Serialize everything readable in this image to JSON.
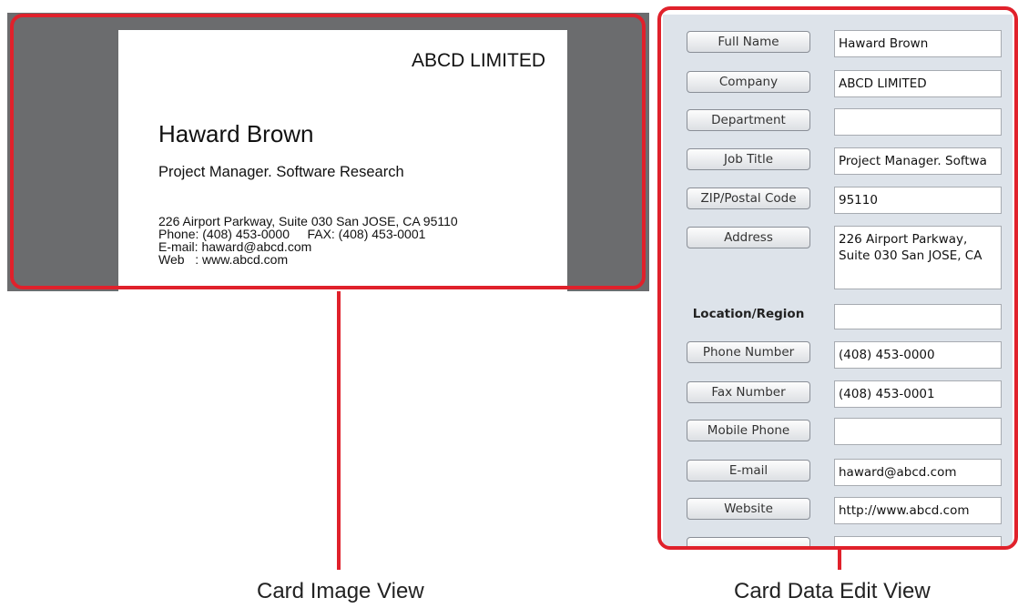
{
  "card_image": {
    "company": "ABCD LIMITED",
    "name": "Haward Brown",
    "job_title": "Project Manager. Software Research",
    "lines": [
      "226 Airport Parkway, Suite 030 San JOSE, CA 95110",
      "Phone: (408) 453-0000     FAX: (408) 453-0001",
      "E-mail: haward@abcd.com",
      "Web   : www.abcd.com"
    ]
  },
  "edit_view": {
    "fields": [
      {
        "label": "Full Name",
        "value": "Haward Brown",
        "kind": "button"
      },
      {
        "label": "Company",
        "value": "ABCD LIMITED",
        "kind": "button"
      },
      {
        "label": "Department",
        "value": "",
        "kind": "button"
      },
      {
        "label": "Job Title",
        "value": "Project Manager. Softwa",
        "kind": "button"
      },
      {
        "label": "ZIP/Postal Code",
        "value": "95110",
        "kind": "button"
      },
      {
        "label": "Address",
        "value": "226 Airport Parkway,\nSuite 030 San JOSE, CA",
        "kind": "button"
      },
      {
        "label": "Location/Region",
        "value": "",
        "kind": "label"
      },
      {
        "label": "Phone Number",
        "value": "(408) 453-0000",
        "kind": "button"
      },
      {
        "label": "Fax Number",
        "value": "(408) 453-0001",
        "kind": "button"
      },
      {
        "label": "Mobile Phone",
        "value": "",
        "kind": "button"
      },
      {
        "label": "E-mail",
        "value": "haward@abcd.com",
        "kind": "button"
      },
      {
        "label": "Website",
        "value": "http://www.abcd.com",
        "kind": "button"
      },
      {
        "label": "",
        "value": "",
        "kind": "button"
      }
    ]
  },
  "captions": {
    "image_view": "Card Image View",
    "edit_view": "Card Data Edit View"
  },
  "colors": {
    "highlight": "#e0212b",
    "image_bg": "#6b6c6e",
    "panel_bg": "#dde3ea"
  }
}
